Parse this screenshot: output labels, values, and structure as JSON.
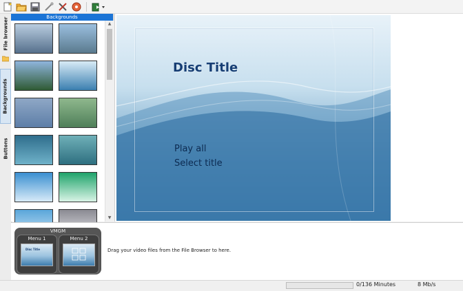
{
  "toolbar": {
    "buttons": [
      {
        "name": "new-project-icon"
      },
      {
        "name": "open-folder-icon"
      },
      {
        "name": "save-icon"
      },
      {
        "name": "edit-wand-icon"
      },
      {
        "name": "tools-icon"
      },
      {
        "name": "burn-disc-icon"
      },
      {
        "name": "export-icon"
      }
    ]
  },
  "sidebar": {
    "tabs": [
      {
        "label": "File browser",
        "active": false
      },
      {
        "label": "Backgrounds",
        "active": true
      },
      {
        "label": "Buttons",
        "active": false
      }
    ]
  },
  "backgrounds": {
    "header": "Backgrounds",
    "thumbnails": [
      {
        "name": "coast-landscape-1",
        "colors": [
          "#b9cde0",
          "#56708c"
        ]
      },
      {
        "name": "coast-landscape-2",
        "colors": [
          "#9bbfdf",
          "#5a7a8e"
        ]
      },
      {
        "name": "lake-forest",
        "colors": [
          "#8fb5dd",
          "#2f5a34"
        ]
      },
      {
        "name": "blue-waves",
        "colors": [
          "#d8ebf6",
          "#3b7fb0"
        ]
      },
      {
        "name": "blue-blur",
        "colors": [
          "#8fa8c6",
          "#5d7ea7"
        ]
      },
      {
        "name": "green-blur",
        "colors": [
          "#8fb88d",
          "#4f7f59"
        ]
      },
      {
        "name": "teal-stripes",
        "colors": [
          "#2f6d8c",
          "#6fb2c9"
        ]
      },
      {
        "name": "teal-texture",
        "colors": [
          "#6fb0b8",
          "#2e6f80"
        ]
      },
      {
        "name": "blue-border-frame",
        "colors": [
          "#3a8fd0",
          "#d8ebf8"
        ]
      },
      {
        "name": "green-border-frame",
        "colors": [
          "#1fa36b",
          "#d9f4e6"
        ]
      },
      {
        "name": "blue-gradient",
        "colors": [
          "#5aa6da",
          "#cfe6f6"
        ]
      },
      {
        "name": "gray-gradient",
        "colors": [
          "#8a8a92",
          "#e9e9ee"
        ]
      }
    ]
  },
  "preview": {
    "disc_title": "Disc Title",
    "items": [
      "Play all",
      "Select title"
    ]
  },
  "bottom": {
    "vmgm_label": "VMGM",
    "menus": [
      {
        "label": "Menu 1",
        "thumb_title": "Disc Title"
      },
      {
        "label": "Menu 2"
      }
    ],
    "drag_hint": "Drag your video files from the File Browser to here."
  },
  "status": {
    "progress_fraction": 0,
    "minutes_text": "0/136 Minutes",
    "bitrate_text": "8 Mb/s"
  },
  "colors": {
    "accent_blue": "#1b74d6",
    "title_blue": "#163e74",
    "progress_green": "#2ea043"
  }
}
